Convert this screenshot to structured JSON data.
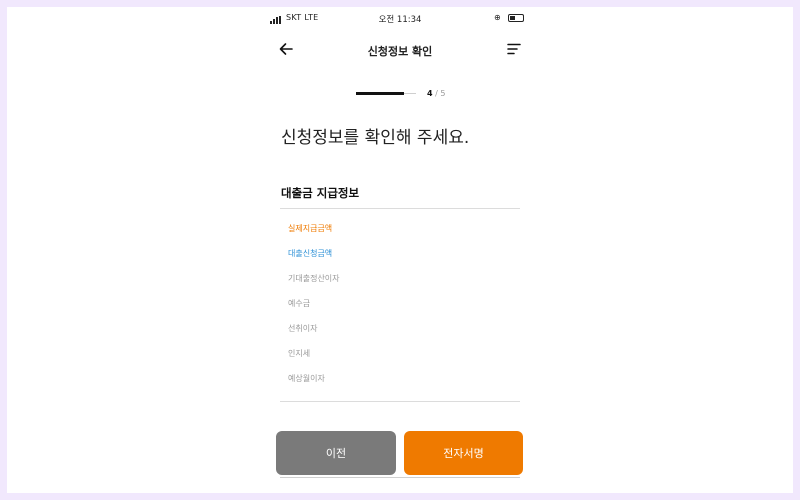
{
  "status_bar": {
    "carrier": "SKT  LTE",
    "time": "오전 11:34"
  },
  "header": {
    "title": "신청정보 확인",
    "back_icon": "arrow-left-icon",
    "menu_icon": "hamburger-menu-icon"
  },
  "progress": {
    "current": "4",
    "separator": " / ",
    "total": "5",
    "fraction": 0.8
  },
  "page_heading": "신청정보를 확인해 주세요.",
  "section": {
    "title": "대출금 지급정보",
    "items": [
      {
        "label": "실제지급금액",
        "color": "#ef7a00"
      },
      {
        "label": "대출신청금액",
        "color": "#2a8fd6"
      },
      {
        "label": "기대출정산이자",
        "color": "#999999"
      },
      {
        "label": "예수금",
        "color": "#999999"
      },
      {
        "label": "선취이자",
        "color": "#999999"
      },
      {
        "label": "인지세",
        "color": "#999999"
      },
      {
        "label": "예상월이자",
        "color": "#999999"
      }
    ]
  },
  "buttons": {
    "prev_label": "이전",
    "sign_label": "전자서명"
  },
  "colors": {
    "accent": "#ef7a00",
    "link_blue": "#2a8fd6",
    "prev_button": "#7a7a7a",
    "frame_border": "#f1e8fd"
  }
}
